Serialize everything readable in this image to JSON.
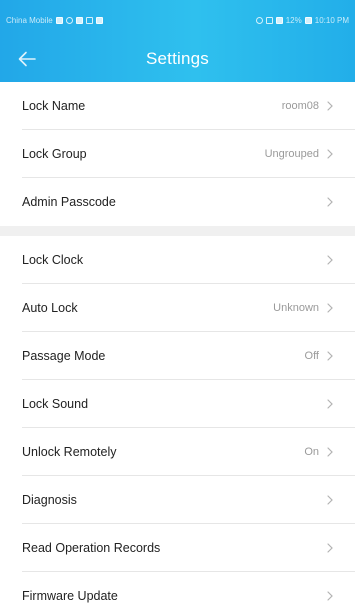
{
  "status_bar": {
    "carrier": "China Mobile",
    "right_text": "12%",
    "time": "10:10 PM"
  },
  "header": {
    "title": "Settings"
  },
  "colors": {
    "header_blue": "#2ab8ec",
    "row_value_gray": "#9a9a9a",
    "label_dark": "#222222",
    "divider": "#e6e6e6",
    "section_bg": "#f0f0f0"
  },
  "groups": [
    {
      "items": [
        {
          "label": "Lock Name",
          "value": "room08"
        },
        {
          "label": "Lock Group",
          "value": "Ungrouped"
        },
        {
          "label": "Admin Passcode",
          "value": ""
        }
      ]
    },
    {
      "items": [
        {
          "label": "Lock Clock",
          "value": ""
        },
        {
          "label": "Auto Lock",
          "value": "Unknown"
        },
        {
          "label": "Passage Mode",
          "value": "Off"
        },
        {
          "label": "Lock Sound",
          "value": ""
        },
        {
          "label": "Unlock Remotely",
          "value": "On"
        },
        {
          "label": "Diagnosis",
          "value": ""
        },
        {
          "label": "Read Operation Records",
          "value": ""
        },
        {
          "label": "Firmware Update",
          "value": ""
        }
      ]
    }
  ],
  "icons": {
    "back": "arrow-left-icon",
    "row_chevron": "chevron-right-icon"
  }
}
